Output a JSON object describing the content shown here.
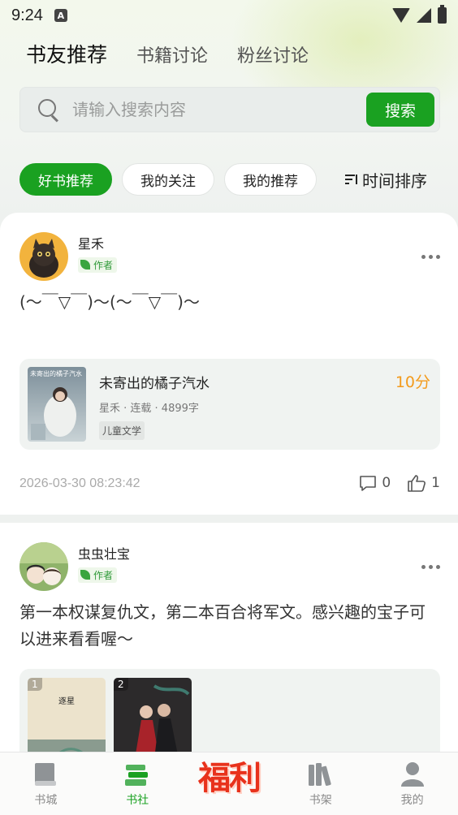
{
  "status_bar": {
    "time": "9:24",
    "notif": "A"
  },
  "tabs": [
    {
      "label": "书友推荐",
      "active": true
    },
    {
      "label": "书籍讨论",
      "active": false
    },
    {
      "label": "粉丝讨论",
      "active": false
    }
  ],
  "search": {
    "placeholder": "请输入搜索内容",
    "button_label": "搜索"
  },
  "filters": [
    {
      "label": "好书推荐",
      "active": true
    },
    {
      "label": "我的关注",
      "active": false
    },
    {
      "label": "我的推荐",
      "active": false
    }
  ],
  "sort": {
    "label": "时间排序"
  },
  "posts": [
    {
      "user": "星禾",
      "badge": "作者",
      "text": "(〜￣▽￣)〜(〜￣▽￣)〜",
      "book": {
        "title": "未寄出的橘子汽水",
        "score": "10分",
        "meta": "星禾 · 连载 · 4899字",
        "tag": "儿童文学",
        "cover_text": "未寄出的橘子汽水"
      },
      "date": "2026-03-30 08:23:42",
      "comments": "0",
      "likes": "1"
    },
    {
      "user": "虫虫壮宝",
      "badge": "作者",
      "text": "第一本权谋复仇文，第二本百合将军文。感兴趣的宝子可以进来看看喔〜",
      "books": [
        {
          "num": "1",
          "cover_text": "逐星"
        },
        {
          "num": "2",
          "cover_text": ""
        }
      ]
    }
  ],
  "bottom_nav": [
    {
      "label": "书城",
      "icon": "book-icon",
      "active": false
    },
    {
      "label": "书社",
      "icon": "books-stack-icon",
      "active": true
    },
    {
      "label": "福利",
      "icon": "welfare-icon",
      "active": false
    },
    {
      "label": "书架",
      "icon": "bookshelf-icon",
      "active": false
    },
    {
      "label": "我的",
      "icon": "profile-icon",
      "active": false
    }
  ],
  "colors": {
    "accent": "#1aa121",
    "score": "#f39a1b",
    "welfare": "#e8321c"
  }
}
